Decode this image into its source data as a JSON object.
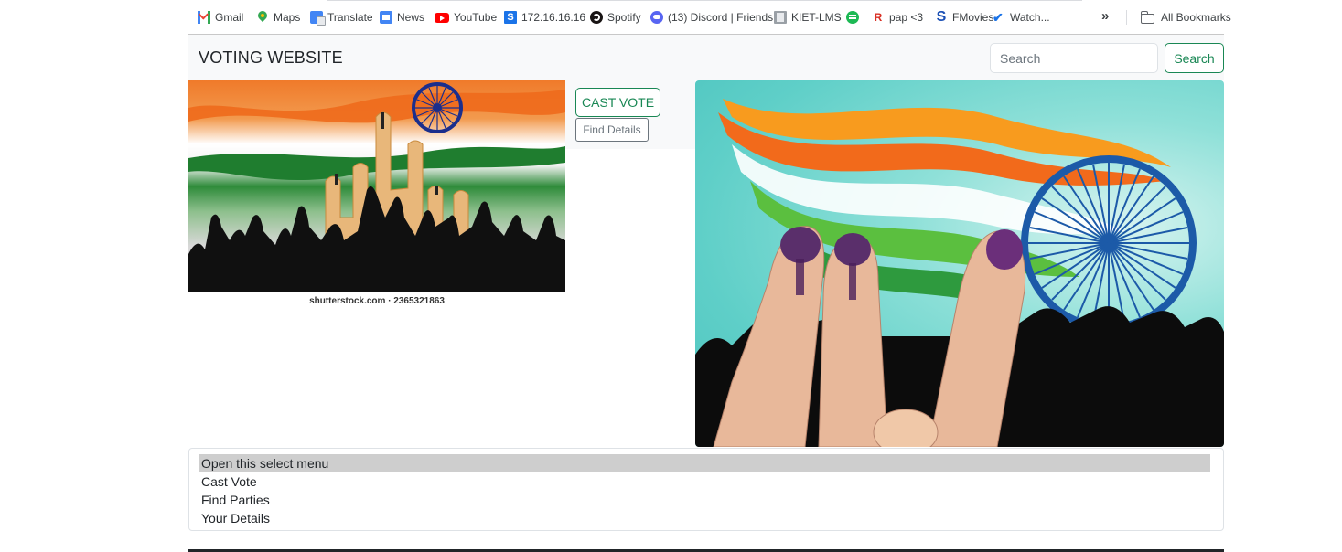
{
  "bookmarks": {
    "items": [
      {
        "label": "Gmail",
        "icon": "gmail-icon"
      },
      {
        "label": "Maps",
        "icon": "maps-icon"
      },
      {
        "label": "Translate",
        "icon": "translate-icon"
      },
      {
        "label": "News",
        "icon": "news-icon"
      },
      {
        "label": "YouTube",
        "icon": "youtube-icon"
      },
      {
        "label": "172.16.16.16",
        "icon": "s-icon"
      },
      {
        "label": "Spotify",
        "icon": "spotify-icon"
      },
      {
        "label": "(13) Discord | Friends",
        "icon": "discord-icon"
      },
      {
        "label": "KIET-LMS",
        "icon": "kiet-icon"
      },
      {
        "label": "",
        "icon": "spotify-green-icon"
      },
      {
        "label": "pap <3",
        "icon": "pap-icon"
      },
      {
        "label": "FMovies",
        "icon": "fmovies-icon"
      },
      {
        "label": "Watch...",
        "icon": "check-icon"
      }
    ],
    "overflow": "»",
    "all_bookmarks": "All Bookmarks"
  },
  "navbar": {
    "brand": "VOTING WEBSITE",
    "search_placeholder": "Search",
    "search_button": "Search"
  },
  "left_image": {
    "credit": "shutterstock.com · 2365321863"
  },
  "actions": {
    "cast_vote": "CAST VOTE",
    "find_details": "Find Details"
  },
  "select_menu": {
    "options": [
      "Open this select menu",
      "Cast Vote",
      "Find Parties",
      "Your Details"
    ],
    "selected_index": 0
  },
  "colors": {
    "success": "#198754",
    "secondary": "#6c757d",
    "navbar_bg": "#f8f9fa",
    "selected_option_bg": "#cecece"
  }
}
